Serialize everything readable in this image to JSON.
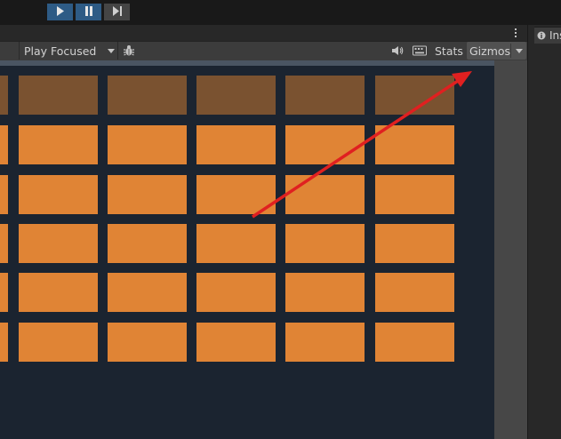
{
  "playmode": {
    "play_label": "Play",
    "pause_label": "Pause",
    "step_label": "Step"
  },
  "game_view": {
    "play_mode_dropdown": "Play Focused",
    "stats_label": "Stats",
    "gizmos_label": "Gizmos"
  },
  "inspector_tab": {
    "label": "Ins"
  },
  "bricks": {
    "rows": 6,
    "columns": 6,
    "top_row_dimmed": true
  },
  "colors": {
    "brick": "#e08435",
    "brick_dim": "#7a5230",
    "game_background": "#1b2430",
    "annotation_arrow": "#e02020"
  }
}
